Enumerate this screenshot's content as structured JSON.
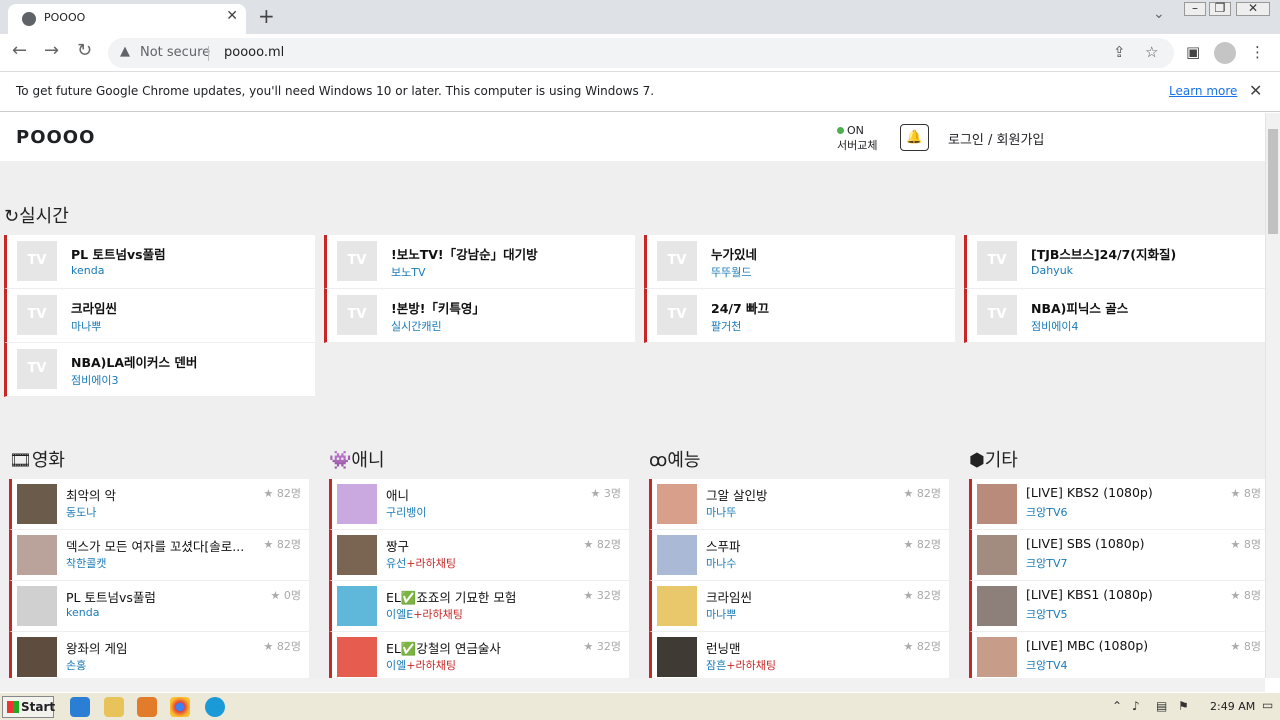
{
  "browser": {
    "tab_title": "POOOO",
    "url": "poooo.ml",
    "security": "Not secure",
    "infobar_message": "To get future Google Chrome updates, you'll need Windows 10 or later. This computer is using Windows 7.",
    "infobar_link": "Learn more"
  },
  "site": {
    "logo": "POOOO",
    "server_status": "ON",
    "server_change": "서버교체",
    "login": "로그인 / 회원가입"
  },
  "live": {
    "title": "실시간",
    "placeholder": "TV",
    "items": [
      {
        "title": "PL 토트넘vs풀럼",
        "sub": "kenda"
      },
      {
        "title": "!보노TV!「강남순」대기방",
        "sub": "보노TV"
      },
      {
        "title": "누가있네",
        "sub": "뚜뚜월드"
      },
      {
        "title": "[TJB스브스]24/7(지화질)",
        "sub": "Dahyuk"
      },
      {
        "title": "크라임씬",
        "sub": "마나뿌"
      },
      {
        "title": "!본방!「키특영」",
        "sub": "실시간캐린"
      },
      {
        "title": "24/7 빠끄",
        "sub": "팔거천"
      },
      {
        "title": "NBA)피닉스 골스",
        "sub": "점비에이4"
      },
      {
        "title": "NBA)LA레이커스 덴버",
        "sub": "점비에이3"
      }
    ]
  },
  "sections": [
    {
      "title": "영화",
      "icon": "film-icon",
      "items": [
        {
          "title": "최악의 악",
          "sub": "동도나",
          "extra": "",
          "views": "82명"
        },
        {
          "title": "덱스가 모든 여자를 꼬셨다[솔로...",
          "sub": "착한콜캣",
          "extra": "",
          "views": "82명"
        },
        {
          "title": "PL 토트넘vs풀럼",
          "sub": "kenda",
          "extra": "",
          "views": "0명"
        },
        {
          "title": "왕좌의 게임",
          "sub": "손홍",
          "extra": "",
          "views": "82명"
        }
      ]
    },
    {
      "title": "애니",
      "icon": "game-controller-icon",
      "items": [
        {
          "title": "애니",
          "sub": "구리뱅이",
          "extra": "",
          "views": "3명"
        },
        {
          "title": "짱구",
          "sub": "유선",
          "extra": "+라하채팅",
          "views": "82명"
        },
        {
          "title": "EL✅죠죠의 기묘한 모험",
          "sub": "이엘E",
          "extra": "+라하채팅",
          "views": "32명"
        },
        {
          "title": "EL✅강철의 연금술사",
          "sub": "이엘",
          "extra": "+라하채팅",
          "views": "32명"
        }
      ]
    },
    {
      "title": "예능",
      "icon": "owl-icon",
      "items": [
        {
          "title": "그알 살인방",
          "sub": "마나뚜",
          "extra": "",
          "views": "82명"
        },
        {
          "title": "스푸파",
          "sub": "마나수",
          "extra": "",
          "views": "82명"
        },
        {
          "title": "크라임씬",
          "sub": "마나뿌",
          "extra": "",
          "views": "82명"
        },
        {
          "title": "런닝맨",
          "sub": "잠흔",
          "extra": "+라하채팅",
          "views": "82명"
        }
      ]
    },
    {
      "title": "기타",
      "icon": "cubes-icon",
      "items": [
        {
          "title": "[LIVE] KBS2 (1080p)",
          "sub": "크앙TV6",
          "extra": "",
          "views": "8명"
        },
        {
          "title": "[LIVE] SBS (1080p)",
          "sub": "크앙TV7",
          "extra": "",
          "views": "8명"
        },
        {
          "title": "[LIVE] KBS1 (1080p)",
          "sub": "크앙TV5",
          "extra": "",
          "views": "8명"
        },
        {
          "title": "[LIVE] MBC (1080p)",
          "sub": "크앙TV4",
          "extra": "",
          "views": "8명"
        }
      ]
    }
  ],
  "taskbar": {
    "start": "Start",
    "clock": "2:49 AM"
  },
  "colors": {
    "accent": "#c62828",
    "link": "#1a7bb8",
    "online": "#4caf50"
  }
}
